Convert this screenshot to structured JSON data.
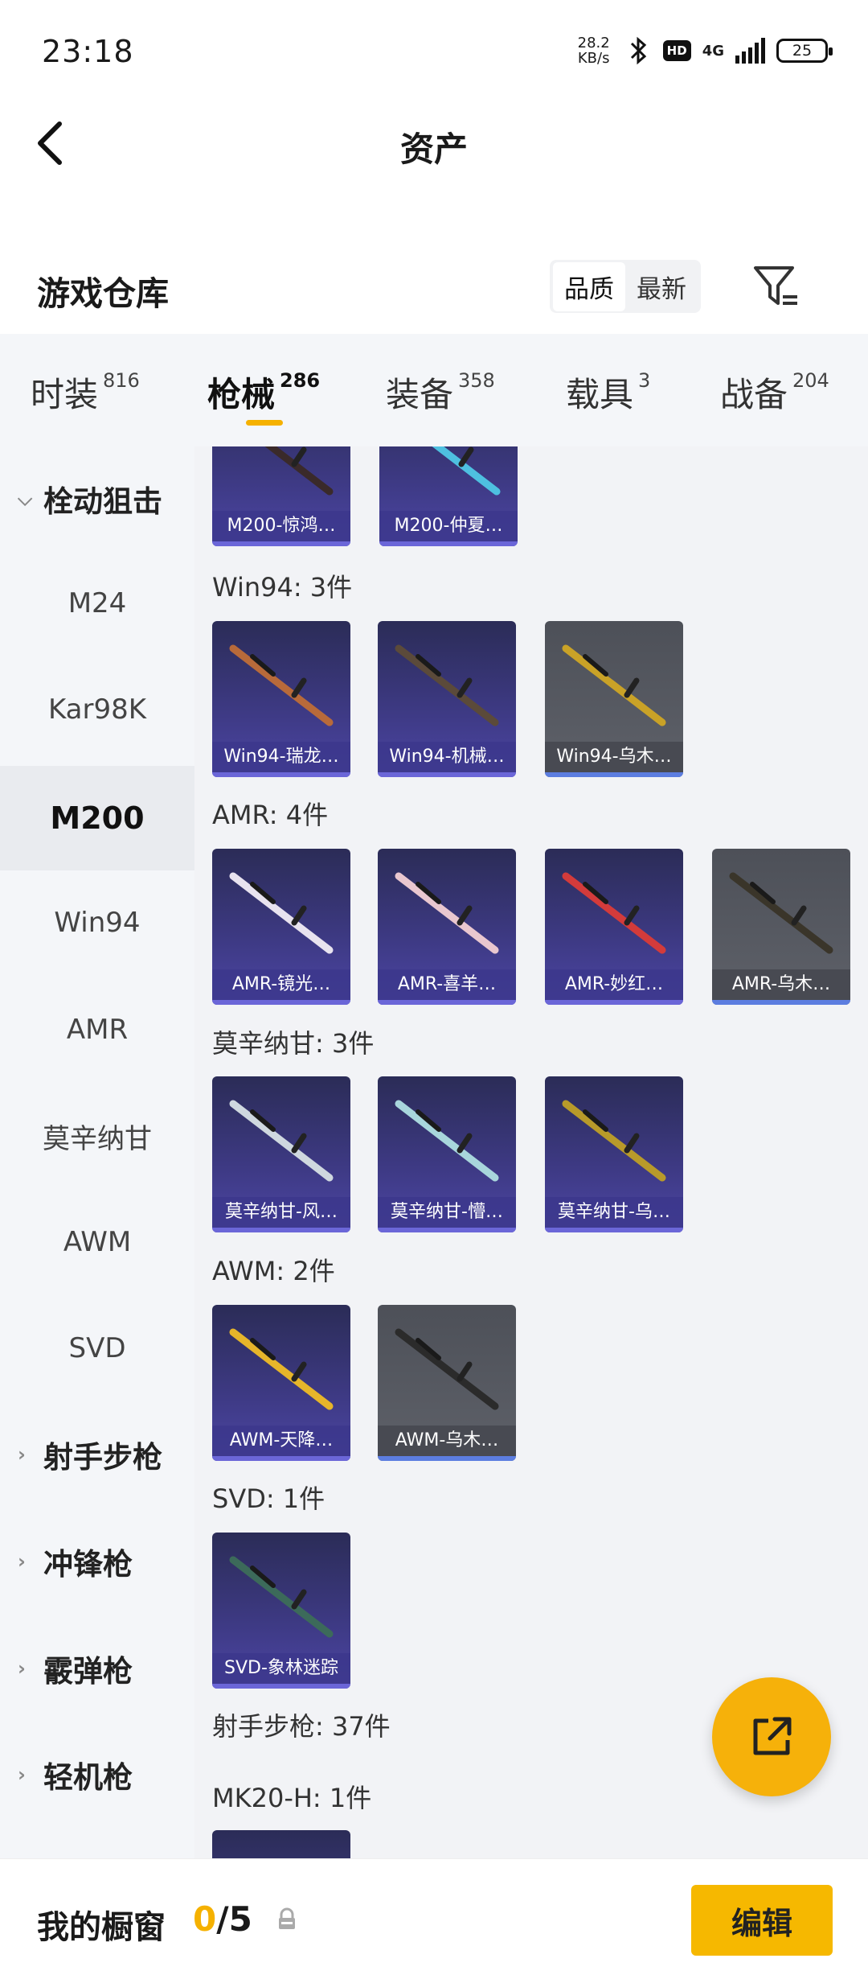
{
  "status_bar": {
    "time": "23:18",
    "speed_value": "28.2",
    "speed_unit": "KB/s",
    "hd": "HD",
    "network": "4G",
    "battery": "25"
  },
  "header": {
    "title": "资产"
  },
  "warehouse": {
    "title": "游戏仓库",
    "sort_options": [
      "品质",
      "最新"
    ],
    "active_sort": "品质"
  },
  "tabs": [
    {
      "label": "时装",
      "count": "816"
    },
    {
      "label": "枪械",
      "count": "286",
      "active": true
    },
    {
      "label": "装备",
      "count": "358"
    },
    {
      "label": "载具",
      "count": "3"
    },
    {
      "label": "战备",
      "count": "204"
    }
  ],
  "sidebar": {
    "items": [
      {
        "label": "栓动狙击",
        "type": "category",
        "chevron": "⌵"
      },
      {
        "label": "M24",
        "type": "sub"
      },
      {
        "label": "Kar98K",
        "type": "sub"
      },
      {
        "label": "M200",
        "type": "sub",
        "selected": true
      },
      {
        "label": "Win94",
        "type": "sub"
      },
      {
        "label": "AMR",
        "type": "sub"
      },
      {
        "label": "莫辛纳甘",
        "type": "sub"
      },
      {
        "label": "AWM",
        "type": "sub"
      },
      {
        "label": "SVD",
        "type": "sub"
      },
      {
        "label": "射手步枪",
        "type": "category",
        "chevron": "›"
      },
      {
        "label": "冲锋枪",
        "type": "category",
        "chevron": "›"
      },
      {
        "label": "霰弹枪",
        "type": "category",
        "chevron": "›"
      },
      {
        "label": "轻机枪",
        "type": "category",
        "chevron": "›"
      }
    ]
  },
  "content": {
    "top_cards": [
      "M200-惊鸿…",
      "M200-仲夏…"
    ],
    "groups": [
      {
        "label": "Win94: 3件",
        "cards": [
          "Win94-瑞龙…",
          "Win94-机械…",
          "Win94-乌木…"
        ],
        "grey": [
          2
        ]
      },
      {
        "label": "AMR: 4件",
        "cards": [
          "AMR-镜光…",
          "AMR-喜羊…",
          "AMR-妙红…",
          "AMR-乌木…"
        ],
        "grey": [
          3
        ]
      },
      {
        "label": "莫辛纳甘: 3件",
        "cards": [
          "莫辛纳甘-风…",
          "莫辛纳甘-懵…",
          "莫辛纳甘-乌…"
        ],
        "grey": []
      },
      {
        "label": "AWM: 2件",
        "cards": [
          "AWM-天降…",
          "AWM-乌木…"
        ],
        "grey": [
          1
        ]
      },
      {
        "label": "SVD: 1件",
        "cards": [
          "SVD-象林迷踪"
        ],
        "grey": []
      }
    ],
    "section_label": "射手步枪: 37件",
    "sub_label": "MK20-H: 1件"
  },
  "bottom": {
    "title": "我的橱窗",
    "current": "0",
    "total": "/5",
    "edit_label": "编辑"
  },
  "colors": {
    "accent": "#f5b100",
    "card_purple": "#3e3a85",
    "card_grey": "#5e6169"
  }
}
